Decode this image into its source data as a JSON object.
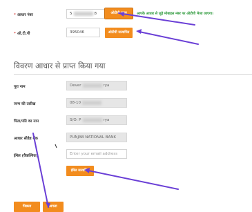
{
  "otp_section": {
    "aadhaar_label": "आधार नंबर",
    "aadhaar_value_visible": "5",
    "aadhaar_value_suffix": "8",
    "send_otp_button": "ओटीपी प्राप्त",
    "otp_info_message": "आपके आधार से जुड़े मोबाइल नंबर पर ओटीपी भेजा जाएगा।",
    "otp_label": "ओ.टी.पी",
    "otp_value": "395046",
    "verify_otp_button": "ओटीपी सत्यापित"
  },
  "details_section": {
    "title": "विवरण आधार से प्राप्त किया गया",
    "fields": [
      {
        "label": "पूरा नाम",
        "value_prefix": "Dever",
        "value_suffix": "rya"
      },
      {
        "label": "जन्म की तारीख",
        "value_prefix": "08-10",
        "value_suffix": ""
      },
      {
        "label": "पिता/पति का नाम",
        "value_prefix": "S/O: P",
        "value_suffix": "rya"
      },
      {
        "label": "आधार सीडेड बैंक",
        "value_prefix": "PUNJAB NATIONAL BANK",
        "value_suffix": ""
      }
    ],
    "email_label": "ईमेल (वैकल्पिक)",
    "email_placeholder": "Enter your email address",
    "verify_email_button": "ईमेल सत्यापित"
  },
  "footer": {
    "previous_button": "पिछला",
    "next_button": "अगला"
  },
  "colors": {
    "accent": "#f28c1e",
    "annotation_arrow": "#6a3fd6",
    "info_green": "#2e9a3c"
  }
}
